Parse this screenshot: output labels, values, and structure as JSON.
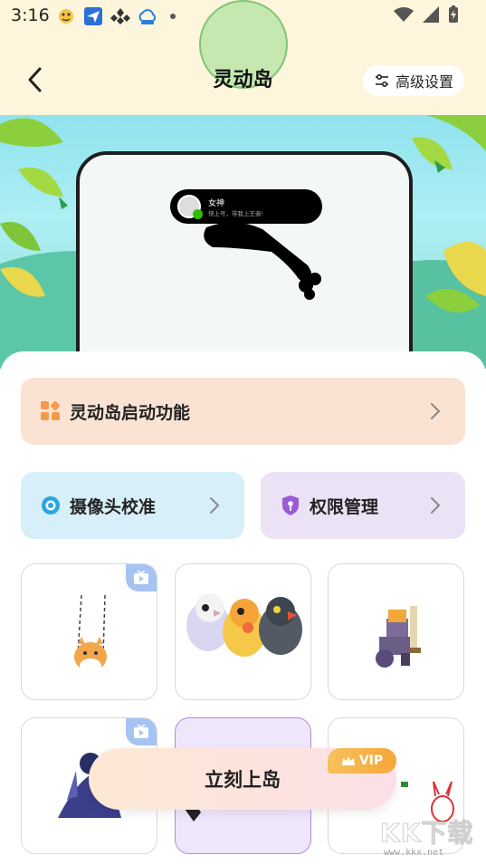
{
  "status_bar": {
    "time": "3:16",
    "left_icons": [
      "app-notification-icon",
      "paper-plane-app-icon",
      "diamond-app-icon",
      "cloud-app-icon"
    ],
    "right_icons": [
      "wifi-icon",
      "signal-icon",
      "battery-charging-icon"
    ]
  },
  "header": {
    "title": "灵动岛",
    "advanced_settings_label": "高级设置"
  },
  "preview": {
    "notification_name": "女神",
    "notification_message": "快上号，带我上王者!"
  },
  "actions": {
    "launch_feature_label": "灵动岛启动功能",
    "camera_calibration_label": "摄像头校准",
    "permission_management_label": "权限管理"
  },
  "tiles": [
    {
      "content": "dog-on-swing-sticker",
      "badge": "tv-icon"
    },
    {
      "content": "three-parrots-sticker",
      "badge": ""
    },
    {
      "content": "pixel-knight-sticker",
      "badge": ""
    },
    {
      "content": "anime-character-sticker",
      "badge": "tv-icon"
    },
    {
      "content": "selected-sticker",
      "badge": ""
    },
    {
      "content": "rabbit-sticker",
      "badge": ""
    }
  ],
  "cta": {
    "label": "立刻上岛",
    "vip_label": "VIP"
  },
  "watermark": {
    "brand": "KK下载",
    "url": "www.kkx.net"
  },
  "colors": {
    "header_bg": "#fdf5dc",
    "launch_card_bg": "#fbe3d3",
    "camera_card_bg": "#d7eff9",
    "permission_card_bg": "#ebe2f6",
    "accent_orange": "#f39a4c",
    "accent_blue": "#2aa6dc",
    "accent_purple": "#9a5ad6",
    "vip_gold": "#f5a63b"
  }
}
